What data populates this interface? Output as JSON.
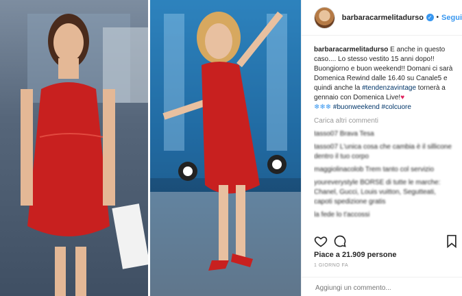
{
  "user": {
    "username": "barbaracarmelitadurso",
    "follow_label": "Segui"
  },
  "caption": {
    "username": "barbaracarmelitadurso",
    "text": " E anche in questo caso.... Lo stesso vestito 15 anni dopo!! Buongiorno e buon weekend!! Domani ci sarà Domenica Rewind dalle 16.40 su Canale5 e quindi anche la ",
    "tag1": "#tendenzavintage",
    "text2": " tornerà a gennaio con Domenica Live!",
    "tag2": "#buonweekend",
    "tag3": "#colcuore"
  },
  "load_more": "Carica altri commenti",
  "comments": [
    "tasso07 Brava Tesa",
    "tasso07 L'unica cosa che cambia è il sillicone dentro il tuo corpo",
    "maggiolinacolob Trem tanto col servizio",
    "youreverystyle BORSE di tutte le marche: Chanel, Gucci, Louis vuitton, Segutteati, capoti spedizione gratis",
    "la fede lo t'accossi"
  ],
  "likes": "Piace a 21.909 persone",
  "time": "1 GIORNO FA",
  "add_comment_placeholder": "Aggiungi un commento...",
  "icons": {
    "like": "heart-icon",
    "comment": "comment-icon",
    "save": "bookmark-icon"
  },
  "colors": {
    "link": "#3897f0",
    "hashtag": "#003569",
    "dress": "#c8201f"
  }
}
